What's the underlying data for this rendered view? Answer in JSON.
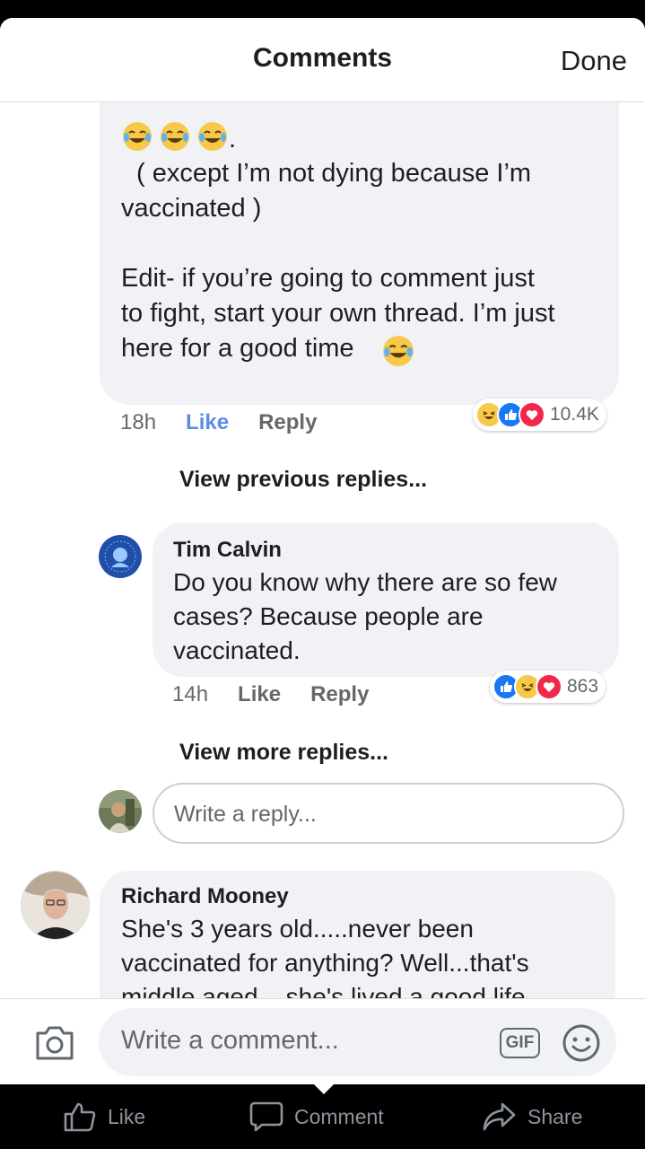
{
  "header": {
    "title": "Comments",
    "done_label": "Done"
  },
  "top_comment": {
    "fragment_text": "( except I’m not dying because I’m\nvaccinated )\n\nEdit- if you’re going to comment just\nto fight, start your own thread. I’m just\nhere for a good time",
    "time": "18h",
    "like_label": "Like",
    "reply_label": "Reply",
    "reaction_count": "10.4K"
  },
  "view_previous": "View previous replies...",
  "reply": {
    "author": "Tim Calvin",
    "text": "Do you know why there are so few\ncases? Because people are\nvaccinated.",
    "time": "14h",
    "like_label": "Like",
    "reply_label": "Reply",
    "reaction_count": "863"
  },
  "view_more": "View more replies...",
  "reply_input": {
    "placeholder": "Write a reply..."
  },
  "comment2": {
    "author": "Richard Mooney",
    "text": "She's 3 years old.....never been\nvaccinated for anything? Well...that's\nmiddle aged ...she's lived a good life..."
  },
  "composer": {
    "placeholder": "Write a comment...",
    "gif_label": "GIF"
  },
  "actions": {
    "like": "Like",
    "comment": "Comment",
    "share": "Share"
  },
  "colors": {
    "accent": "#1877f2",
    "like_active": "#5b8ee6",
    "love": "#f0284a",
    "haha": "#f7c84a"
  }
}
